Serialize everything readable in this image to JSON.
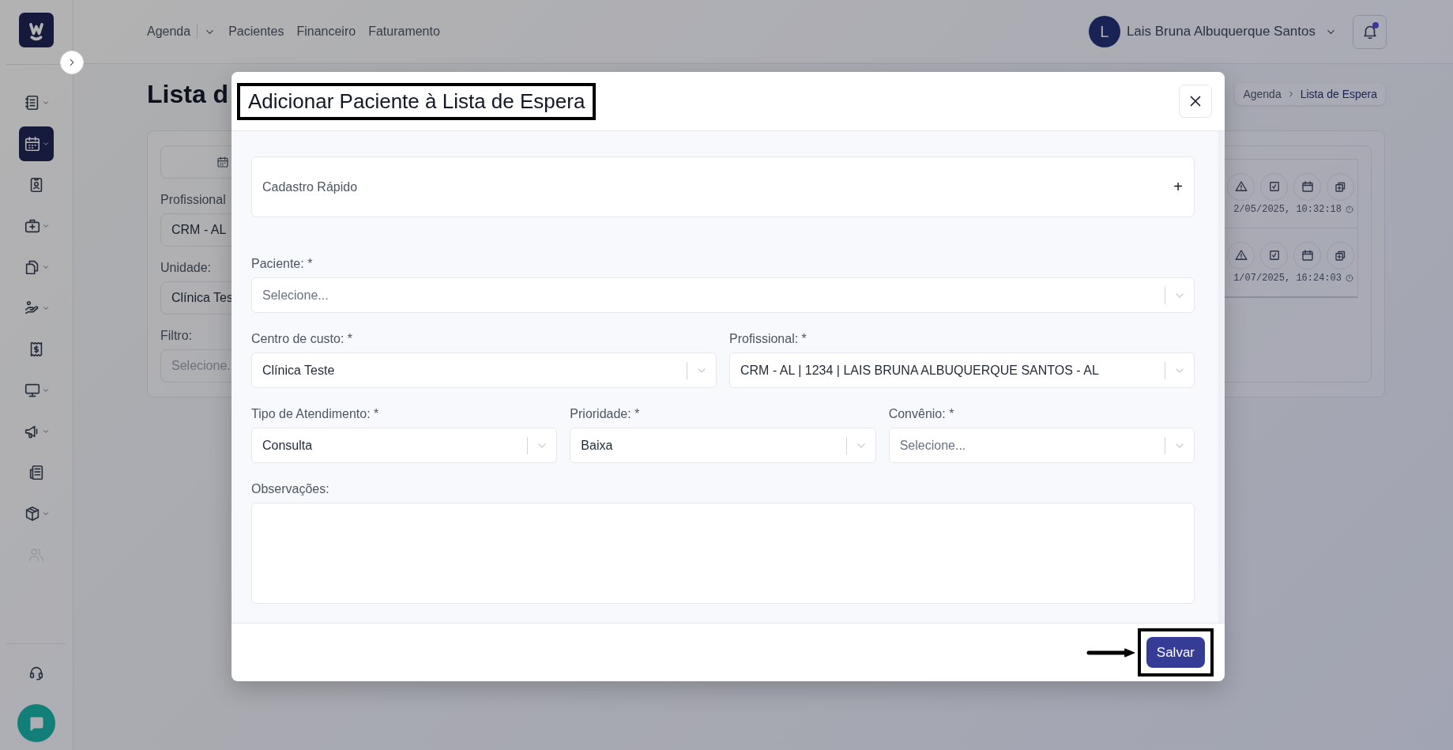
{
  "sidebar": {
    "items": [
      {
        "kind": "notebook",
        "dropdown": true,
        "selected": false,
        "disabled": false
      },
      {
        "kind": "calendar",
        "dropdown": true,
        "selected": true,
        "disabled": false
      },
      {
        "kind": "id-badge",
        "dropdown": false,
        "selected": false,
        "disabled": false
      },
      {
        "kind": "medkit",
        "dropdown": true,
        "selected": false,
        "disabled": false
      },
      {
        "kind": "files",
        "dropdown": true,
        "selected": false,
        "disabled": false
      },
      {
        "kind": "hand",
        "dropdown": true,
        "selected": false,
        "disabled": false
      },
      {
        "kind": "receipt",
        "dropdown": false,
        "selected": false,
        "disabled": false
      },
      {
        "kind": "monitor",
        "dropdown": true,
        "selected": false,
        "disabled": false
      },
      {
        "kind": "megaphone",
        "dropdown": true,
        "selected": false,
        "disabled": false
      },
      {
        "kind": "newspaper",
        "dropdown": false,
        "selected": false,
        "disabled": false
      },
      {
        "kind": "package",
        "dropdown": true,
        "selected": false,
        "disabled": false
      },
      {
        "kind": "users",
        "dropdown": false,
        "selected": false,
        "disabled": true
      }
    ],
    "bottom": [
      {
        "kind": "headset"
      }
    ]
  },
  "header": {
    "nav": [
      {
        "label": "Agenda",
        "dropdown": true
      },
      {
        "label": "Pacientes",
        "dropdown": false
      },
      {
        "label": "Financeiro",
        "dropdown": false
      },
      {
        "label": "Faturamento",
        "dropdown": false
      }
    ],
    "user": {
      "initial": "L",
      "name": "Lais Bruna Albuquerque Santos"
    },
    "notifications": {
      "unread": true
    }
  },
  "page": {
    "title": "Lista d",
    "breadcrumb": [
      {
        "label": "Agenda",
        "selected": false
      },
      {
        "label": "Lista de Espera",
        "selected": true
      }
    ],
    "filters": [
      {
        "label": "Profissional",
        "value": "CRM - AL"
      },
      {
        "label": "Unidade:",
        "value": "Clínica Tes"
      },
      {
        "label": "Filtro:",
        "placeholder": "Selecione."
      }
    ],
    "entries": [
      {
        "timestamp": "2/05/2025, 10:32:18"
      },
      {
        "timestamp": "1/07/2025, 16:24:03"
      }
    ]
  },
  "modal": {
    "title": "Adicionar Paciente à Lista de Espera",
    "title_highlighted": true,
    "quick_register": {
      "label": "Cadastro Rápido",
      "toggle": "+"
    },
    "rows": [
      {
        "fields": [
          {
            "kind": "select",
            "label": "Paciente: *",
            "placeholder": "Selecione..."
          }
        ]
      },
      {
        "fields": [
          {
            "kind": "select",
            "label": "Centro de custo: *",
            "value": "Clínica Teste"
          },
          {
            "kind": "select",
            "label": "Profissional: *",
            "value": "CRM - AL | 1234 | LAIS BRUNA ALBUQUERQUE SANTOS - AL"
          }
        ]
      },
      {
        "fields": [
          {
            "kind": "select",
            "label": "Tipo de Atendimento: *",
            "value": "Consulta"
          },
          {
            "kind": "select",
            "label": "Prioridade: *",
            "value": "Baixa"
          },
          {
            "kind": "select",
            "label": "Convênio: *",
            "placeholder": "Selecione..."
          }
        ]
      },
      {
        "fields": [
          {
            "kind": "textarea",
            "label": "Observações:"
          }
        ]
      }
    ],
    "save_button": {
      "label": "Salvar",
      "highlighted": true,
      "pointer_arrow": true
    }
  }
}
